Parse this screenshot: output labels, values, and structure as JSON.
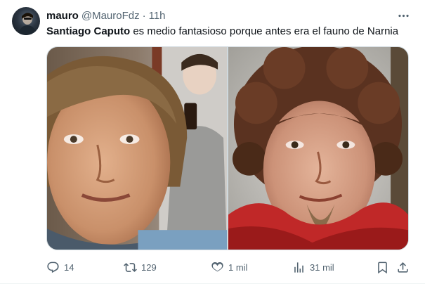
{
  "tweet": {
    "author_name": "mauro",
    "author_handle": "@MauroFdz",
    "separator": "·",
    "time": "11h",
    "text_bold": "Santiago Caputo",
    "text_rest": " es medio fantasioso porque antes era el fauno de Narnia",
    "media": [
      {
        "name": "photo-selfie"
      },
      {
        "name": "photo-faun"
      }
    ]
  },
  "actions": {
    "replies": "14",
    "retweets": "129",
    "likes": "1 mil",
    "views": "31 mil"
  },
  "icons": {
    "more": "more-horizontal-icon",
    "reply": "reply-icon",
    "retweet": "retweet-icon",
    "like": "heart-icon",
    "views": "bar-chart-icon",
    "bookmark": "bookmark-icon",
    "share": "share-icon"
  },
  "colors": {
    "text_primary": "#0f1419",
    "text_secondary": "#536471",
    "border": "#cfd9de"
  }
}
